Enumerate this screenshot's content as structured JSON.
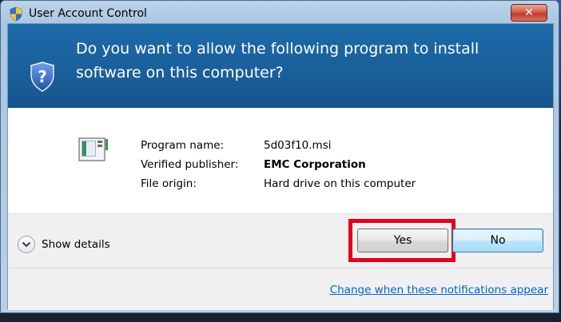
{
  "window": {
    "title": "User Account Control",
    "close_glyph": "✕"
  },
  "header": {
    "question": "Do you want to allow the following program to install software on this computer?"
  },
  "program": {
    "rows": [
      {
        "label": "Program name:",
        "value": "5d03f10.msi",
        "bold": false
      },
      {
        "label": "Verified publisher:",
        "value": "EMC Corporation",
        "bold": true
      },
      {
        "label": "File origin:",
        "value": "Hard drive on this computer",
        "bold": false
      }
    ]
  },
  "footer": {
    "details_label": "Show details",
    "yes_label": "Yes",
    "no_label": "No",
    "notify_link": "Change when these notifications appear"
  },
  "colors": {
    "header_bg": "#1a5f9a",
    "highlight": "#e3001b",
    "link": "#0066cc"
  },
  "icons": [
    "uac-shield-icon",
    "close-icon",
    "question-shield-icon",
    "installer-program-icon",
    "chevron-down-icon"
  ]
}
